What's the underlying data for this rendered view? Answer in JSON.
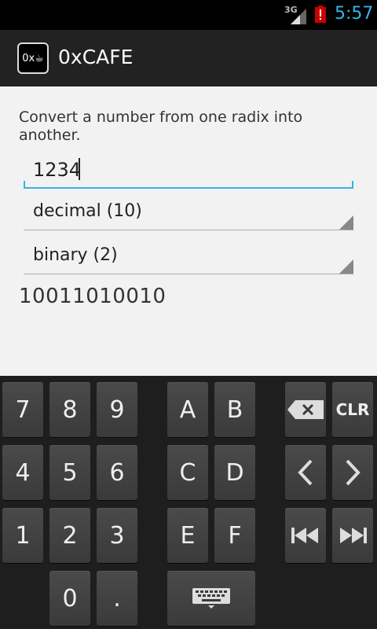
{
  "status_bar": {
    "network": "3G",
    "time": "5:57"
  },
  "app": {
    "icon_label": "0x☕",
    "title": "0xCAFE"
  },
  "converter": {
    "description": "Convert a number from one radix into another.",
    "input_value": "1234",
    "from_radix": "decimal (10)",
    "to_radix": "binary (2)",
    "result": "10011010010"
  },
  "keypad": {
    "k7": "7",
    "k8": "8",
    "k9": "9",
    "kA": "A",
    "kB": "B",
    "k4": "4",
    "k5": "5",
    "k6": "6",
    "kC": "C",
    "kD": "D",
    "k1": "1",
    "k2": "2",
    "k3": "3",
    "kE": "E",
    "kF": "F",
    "k0": "0",
    "kdot": ".",
    "clr": "CLR"
  },
  "icons": {
    "backspace": "backspace-icon",
    "left": "chevron-left-icon",
    "right": "chevron-right-icon",
    "home": "skip-to-start-icon",
    "end": "skip-to-end-icon",
    "keyboard": "keyboard-icon"
  },
  "colors": {
    "accent": "#33b5e5",
    "battery_alert": "#cc0000"
  }
}
